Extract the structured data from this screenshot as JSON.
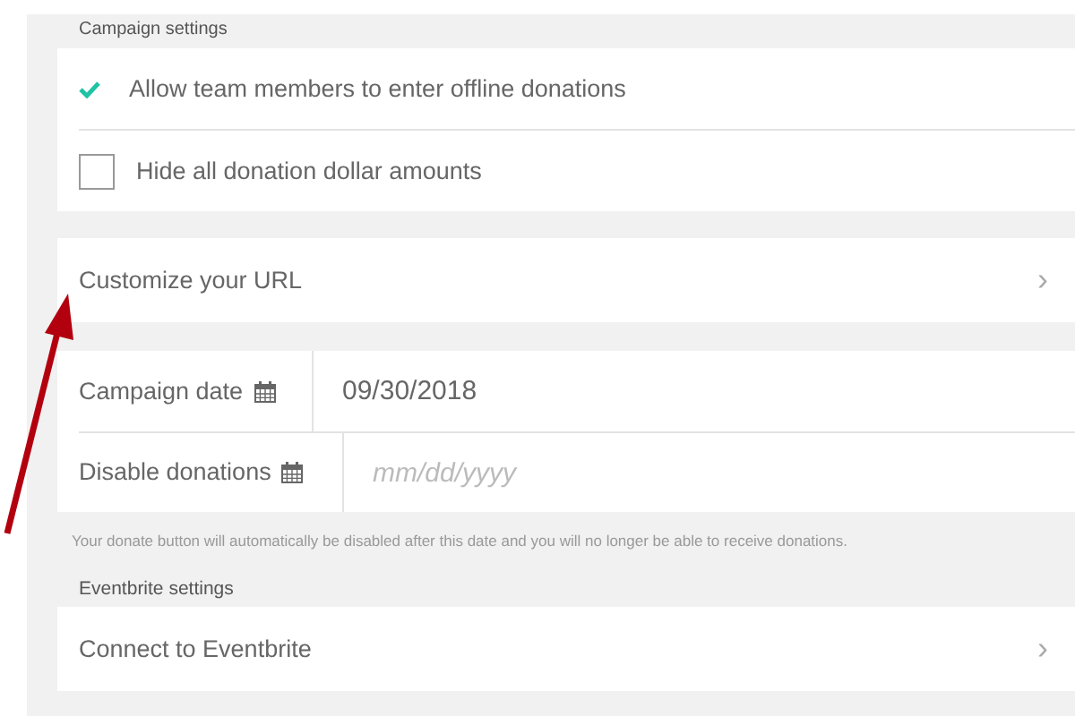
{
  "campaign_settings": {
    "heading": "Campaign settings",
    "options": [
      {
        "label": "Allow team members to enter offline donations",
        "checked": true
      },
      {
        "label": "Hide all donation dollar amounts",
        "checked": false
      }
    ]
  },
  "url_link": {
    "label": "Customize your URL",
    "chevron": "›"
  },
  "dates": [
    {
      "label": "Campaign date",
      "value": "09/30/2018"
    },
    {
      "label": "Disable donations",
      "placeholder": "mm/dd/yyyy"
    }
  ],
  "dates_help": "Your donate button will automatically be disabled after this date and you will no longer be able to receive donations.",
  "eventbrite": {
    "heading": "Eventbrite settings",
    "link": {
      "label": "Connect to Eventbrite",
      "chevron": "›"
    }
  }
}
